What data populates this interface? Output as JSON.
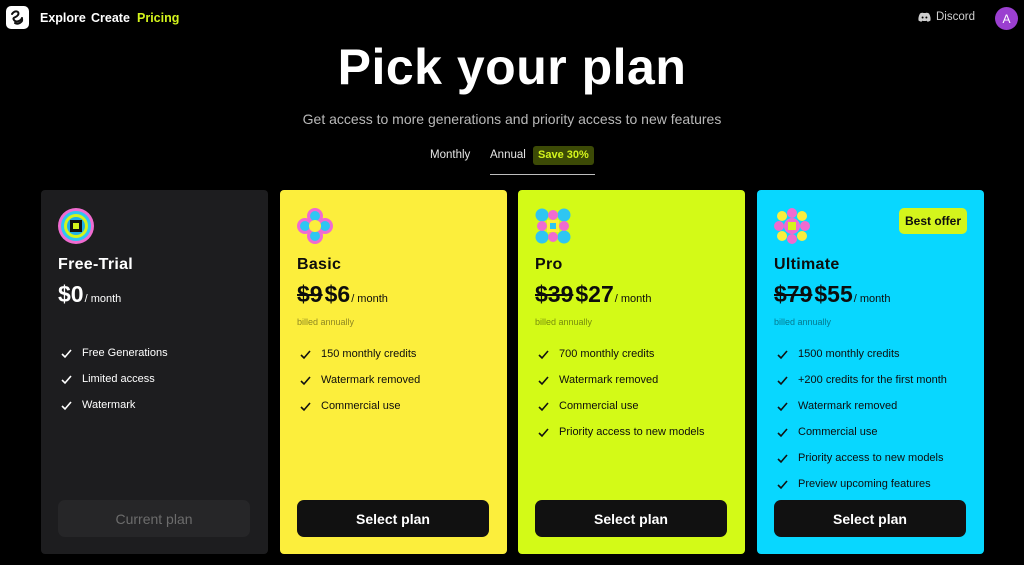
{
  "nav": {
    "links": [
      {
        "label": "Explore"
      },
      {
        "label": "Create"
      },
      {
        "label": "Pricing"
      }
    ],
    "discord_label": "Discord",
    "avatar_letter": "A"
  },
  "hero": {
    "title": "Pick your plan",
    "subtitle": "Get access to more generations and priority access to new features"
  },
  "billing_toggle": {
    "monthly_label": "Monthly",
    "annual_label": "Annual",
    "save_badge": "Save 30%",
    "selected": "Annual"
  },
  "plans": [
    {
      "name": "Free-Trial",
      "old_price": "",
      "price": "$0",
      "per": "/ month",
      "billed": "",
      "features": [
        "Free Generations",
        "Limited access",
        "Watermark"
      ],
      "cta": "Current plan"
    },
    {
      "name": "Basic",
      "old_price": "$9",
      "price": "$6",
      "per": "/ month",
      "billed": "billed annually",
      "features": [
        "150 monthly credits",
        "Watermark removed",
        "Commercial use"
      ],
      "cta": "Select plan"
    },
    {
      "name": "Pro",
      "old_price": "$39",
      "price": "$27",
      "per": "/ month",
      "billed": "billed annually",
      "features": [
        "700 monthly credits",
        "Watermark removed",
        "Commercial use",
        "Priority access to new models"
      ],
      "cta": "Select plan"
    },
    {
      "name": "Ultimate",
      "badge": "Best offer",
      "old_price": "$79",
      "price": "$55",
      "per": "/ month",
      "billed": "billed annually",
      "features": [
        "1500 monthly credits",
        "+200 credits for the first month",
        "Watermark removed",
        "Commercial use",
        "Priority access to new models",
        "Preview upcoming features"
      ],
      "cta": "Select plan"
    }
  ],
  "colors": {
    "accent": "#d4f51c",
    "basic_card": "#fcee3c",
    "pro_card": "#d3fa17",
    "ultimate_card": "#08d7ff",
    "free_card": "#1d1d1f"
  }
}
